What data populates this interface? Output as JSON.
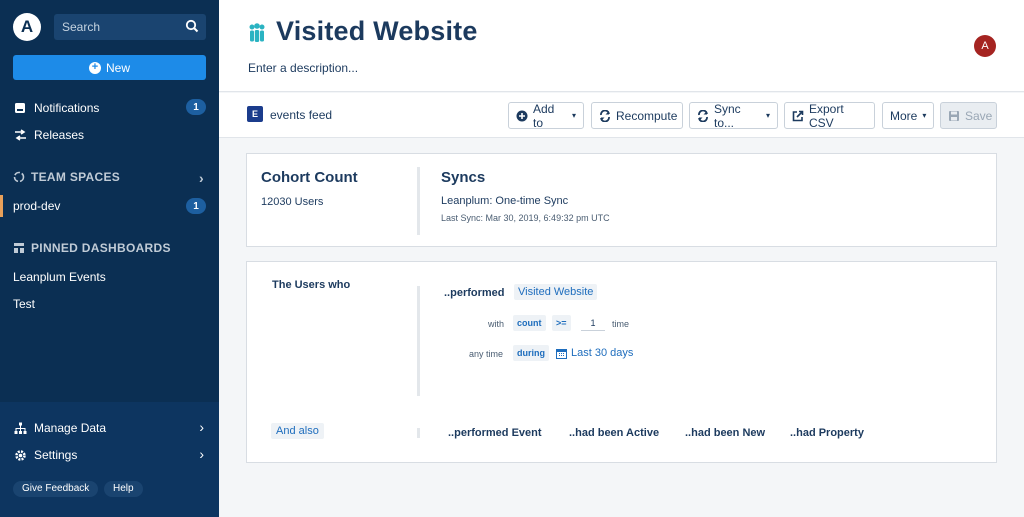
{
  "sidebar": {
    "logo": "A",
    "search_placeholder": "Search",
    "new_label": "New",
    "notifications": {
      "label": "Notifications",
      "count": "1"
    },
    "releases": "Releases",
    "team_spaces": "TEAM SPACES",
    "prod_dev": {
      "label": "prod-dev",
      "count": "1"
    },
    "pinned_dashboards": "PINNED DASHBOARDS",
    "pinned_items": [
      "Leanplum Events",
      "Test"
    ],
    "manage_data": "Manage Data",
    "settings": "Settings",
    "give_feedback": "Give Feedback",
    "help": "Help"
  },
  "header": {
    "title": "Visited Website",
    "description_placeholder": "Enter a description...",
    "avatar_initial": "A"
  },
  "toolbar": {
    "event_badge": "E",
    "feed_label": "events feed",
    "add_to": "Add to",
    "recompute": "Recompute",
    "sync_to": "Sync to...",
    "export_csv": "Export CSV",
    "more": "More",
    "save": "Save"
  },
  "summary": {
    "cohort_count_title": "Cohort Count",
    "cohort_count_value": "12030",
    "cohort_count_unit": "Users",
    "syncs_title": "Syncs",
    "sync_name": "Leanplum: One-time Sync",
    "last_sync": "Last Sync: Mar 30, 2019, 6:49:32 pm UTC"
  },
  "definition": {
    "users_who": "The Users who",
    "performed": "..performed",
    "event_name": "Visited Website",
    "with": "with",
    "metric": "count",
    "operator": ">=",
    "value": "1",
    "time": "time",
    "any_time": "any time",
    "during": "during",
    "range": "Last 30 days",
    "and_also": "And also",
    "add_performed_event": "..performed Event",
    "add_active": "..had been Active",
    "add_new": "..had been New",
    "add_property": "..had Property"
  },
  "colors": {
    "sidebar_bg": "#0b2f53",
    "accent_blue": "#1d8be8",
    "title_navy": "#1c3a5e",
    "link_blue": "#1e6dbd",
    "avatar_red": "#a52421"
  }
}
